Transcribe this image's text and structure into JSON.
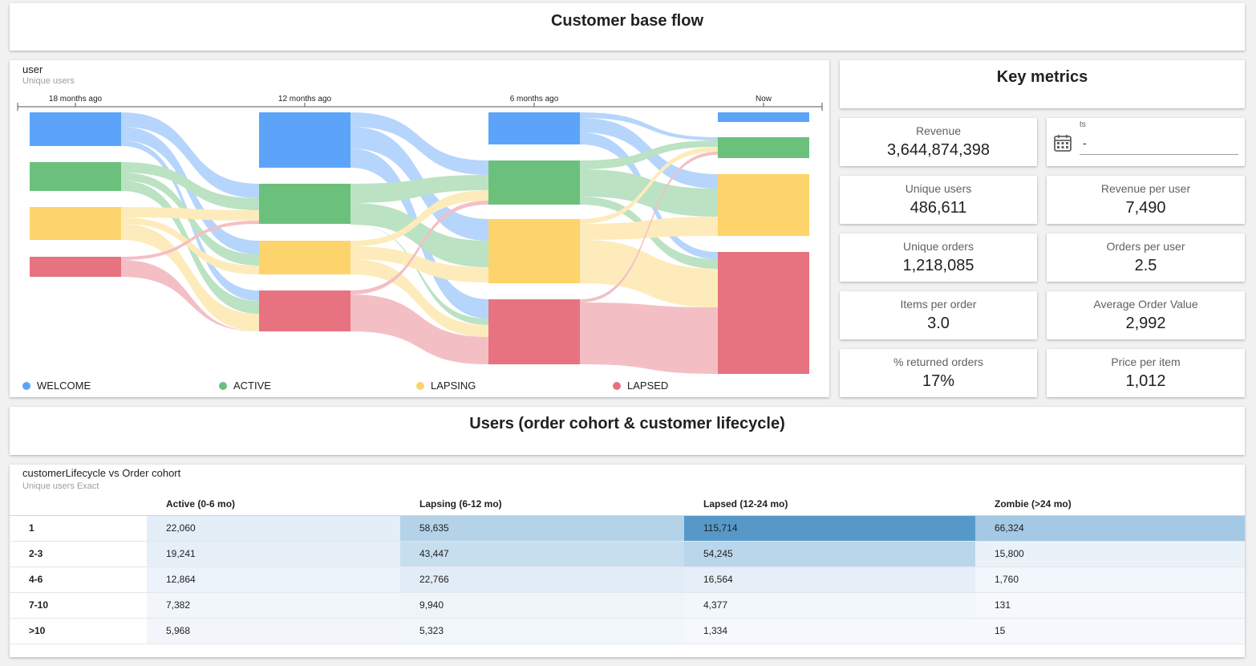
{
  "header": {
    "title": "Customer base flow"
  },
  "sankey": {
    "title": "user",
    "subtitle": "Unique users",
    "time_labels": [
      "18 months ago",
      "12 months ago",
      "6 months ago",
      "Now"
    ],
    "legend": [
      {
        "label": "WELCOME",
        "color": "#5ca4f9"
      },
      {
        "label": "ACTIVE",
        "color": "#6bc17c"
      },
      {
        "label": "LAPSING",
        "color": "#fdd36b"
      },
      {
        "label": "LAPSED",
        "color": "#e6737f"
      }
    ]
  },
  "metrics": {
    "title": "Key metrics",
    "date_filter": {
      "label": "ts",
      "value": "-"
    },
    "kpis": [
      {
        "label": "Revenue",
        "value": "3,644,874,398"
      },
      {
        "label": "Unique users",
        "value": "486,611"
      },
      {
        "label": "Revenue per user",
        "value": "7,490"
      },
      {
        "label": "Unique orders",
        "value": "1,218,085"
      },
      {
        "label": "Orders per user",
        "value": "2.5"
      },
      {
        "label": "Items per order",
        "value": "3.0"
      },
      {
        "label": "Average Order Value",
        "value": "2,992"
      },
      {
        "label": "% returned orders",
        "value": "17%"
      },
      {
        "label": "Price per item",
        "value": "1,012"
      }
    ]
  },
  "section2": {
    "title": "Users (order cohort & customer lifecycle)"
  },
  "pivot": {
    "title": "customerLifecycle vs Order cohort",
    "subtitle": "Unique users Exact",
    "columns": [
      "Active (0-6 mo)",
      "Lapsing (6-12 mo)",
      "Lapsed (12-24 mo)",
      "Zombie (>24 mo)"
    ],
    "rows": [
      {
        "label": "1",
        "values": [
          "22,060",
          "58,635",
          "115,714",
          "66,324"
        ]
      },
      {
        "label": "2-3",
        "values": [
          "19,241",
          "43,447",
          "54,245",
          "15,800"
        ]
      },
      {
        "label": "4-6",
        "values": [
          "12,864",
          "22,766",
          "16,564",
          "1,760"
        ]
      },
      {
        "label": "7-10",
        "values": [
          "7,382",
          "9,940",
          "4,377",
          "131"
        ]
      },
      {
        "label": ">10",
        "values": [
          "5,968",
          "5,323",
          "1,334",
          "15"
        ]
      }
    ],
    "cell_colors": [
      [
        "#e4eef8",
        "#b4d3e9",
        "#5699c9",
        "#a4c9e4"
      ],
      [
        "#e6eff8",
        "#c7deef",
        "#b9d6eb",
        "#e9f2f9"
      ],
      [
        "#ecf3fa",
        "#e2ecf7",
        "#e6eff8",
        "#f2f7fc"
      ],
      [
        "#f1f6fb",
        "#eef4fa",
        "#f2f7fc",
        "#f5f9fd"
      ],
      [
        "#f2f6fb",
        "#f2f7fc",
        "#f5f9fd",
        "#f5f9fd"
      ]
    ]
  }
}
